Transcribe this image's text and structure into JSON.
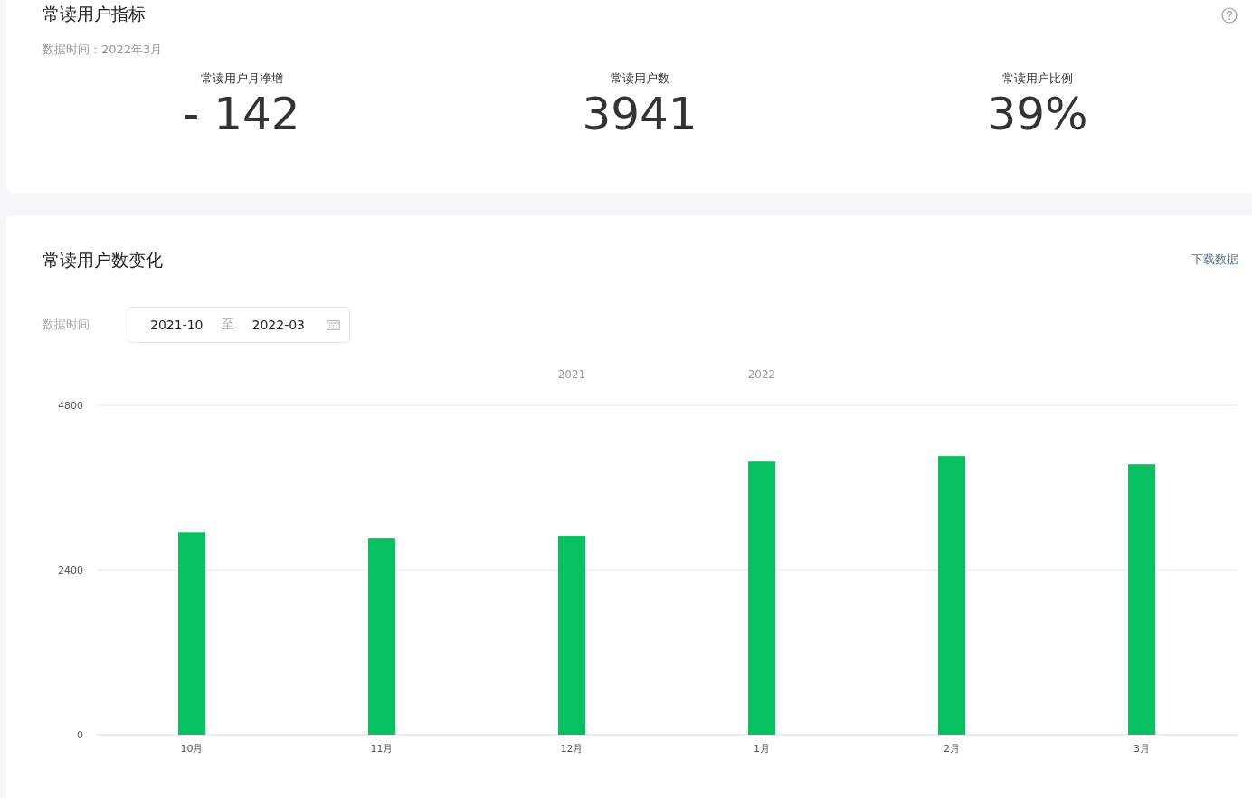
{
  "summary": {
    "title": "常读用户指标",
    "data_time": "数据时间：2022年3月",
    "metrics": [
      {
        "label": "常读用户月净增",
        "value": "- 142"
      },
      {
        "label": "常读用户数",
        "value": "3941"
      },
      {
        "label": "常读用户比例",
        "value": "39%"
      }
    ]
  },
  "trend": {
    "title": "常读用户数变化",
    "download_link": "下载数据",
    "filter_label": "数据时间",
    "date_start": "2021-10",
    "date_separator": "至",
    "date_end": "2022-03",
    "chart_data": {
      "type": "bar",
      "categories": [
        "10月",
        "11月",
        "12月",
        "1月",
        "2月",
        "3月"
      ],
      "values": [
        2950,
        2860,
        2900,
        3980,
        4060,
        3940
      ],
      "ylim": [
        0,
        4800
      ],
      "yticks": [
        0,
        2400,
        4800
      ],
      "annotations": [
        "2021",
        "2022"
      ]
    }
  }
}
